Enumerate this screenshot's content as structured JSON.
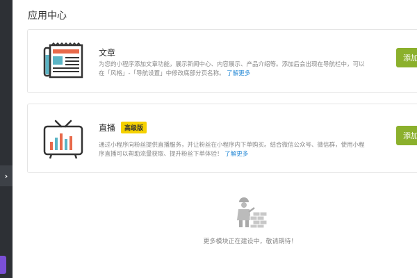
{
  "page_title": "应用中心",
  "cards": [
    {
      "title": "文章",
      "badge": "",
      "description": "为您的小程序添加文章功能，展示新闻中心、内容展示、产品介绍等。添加后会出现在导航栏中，可以在「风格」-「导航设置」中修改底部分页名称。",
      "link": "了解更多",
      "button": "添加",
      "icon": "newspaper-icon"
    },
    {
      "title": "直播",
      "badge": "高级版",
      "description": "通过小程序向粉丝提供直播服务，并让粉丝在小程序内下单购买。结合微信公众号、微信群，使用小程序直播可以帮助流量获取、提升粉丝下单体验！",
      "link": "了解更多",
      "button": "添加",
      "icon": "tv-chart-icon"
    }
  ],
  "construction": {
    "text": "更多模块正在建设中，敬请期待！",
    "icon": "construction-worker-icon"
  },
  "sidebar": {
    "toggle_icon": "chevron-right-icon"
  },
  "colors": {
    "accent_button": "#8bb02c",
    "badge": "#f5d100",
    "link": "#2a8bd6",
    "sidebar": "#2d3035"
  }
}
